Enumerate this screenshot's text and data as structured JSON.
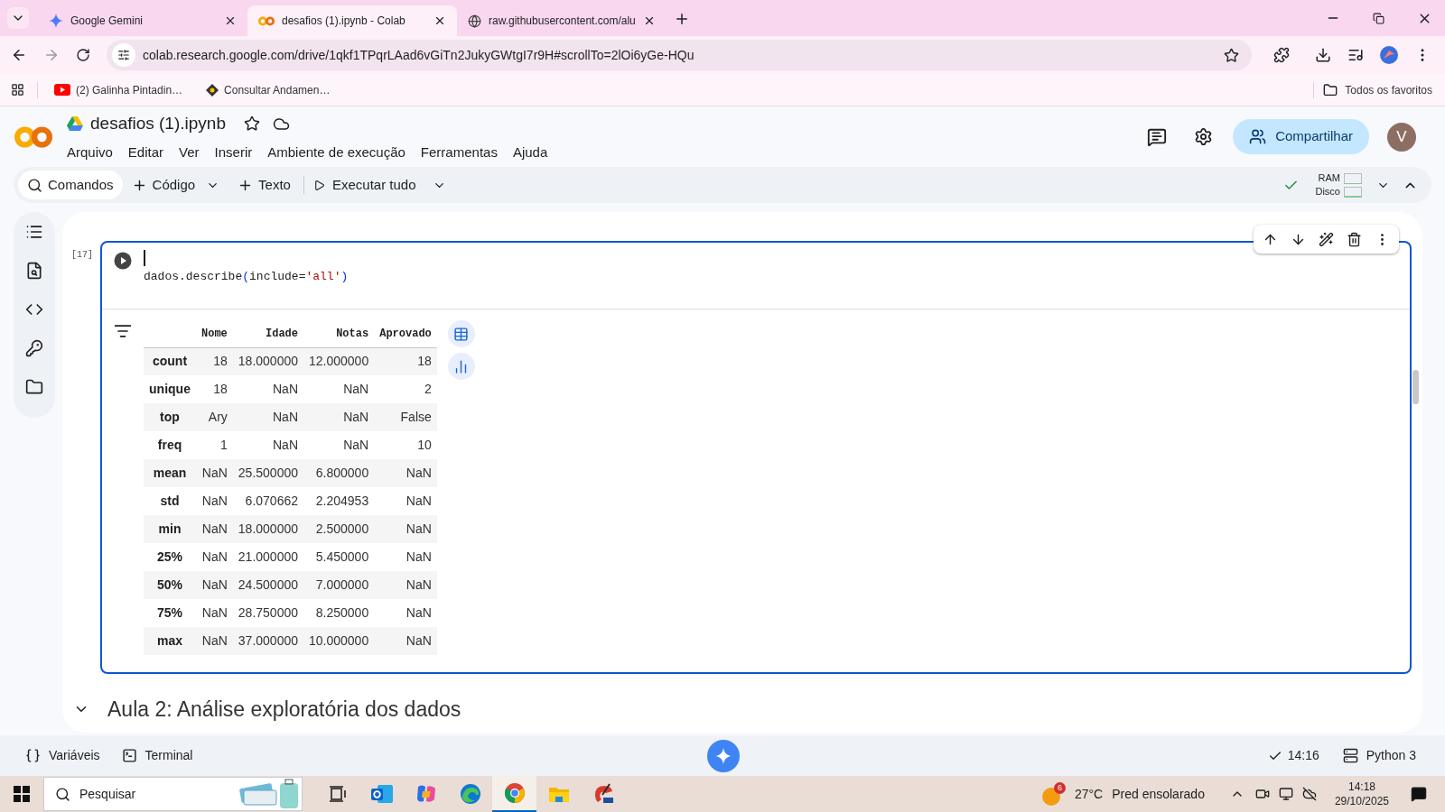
{
  "browser": {
    "tabs": [
      {
        "title": "Google Gemini",
        "kind": "gemini",
        "selected": false
      },
      {
        "title": "desafios (1).ipynb - Colab",
        "kind": "colab",
        "selected": true
      },
      {
        "title": "raw.githubusercontent.com/alu",
        "kind": "globe",
        "selected": false
      }
    ],
    "url": "colab.research.google.com/drive/1qkf1TPqrLAad6vGiTn2JukyGWtgI7r9H#scrollTo=2lOi6yGe-HQu",
    "bookmarks": [
      {
        "title": "(2) Galinha Pintadin…",
        "kind": "youtube"
      },
      {
        "title": "Consultar Andamen…",
        "kind": "diamond"
      }
    ],
    "all_bookmarks": "Todos os favoritos"
  },
  "colab": {
    "notebook_title": "desafios (1).ipynb",
    "menu": [
      "Arquivo",
      "Editar",
      "Ver",
      "Inserir",
      "Ambiente de execução",
      "Ferramentas",
      "Ajuda"
    ],
    "share": "Compartilhar",
    "avatar": "V"
  },
  "toolbar": {
    "commands": "Comandos",
    "code": "Código",
    "text": "Texto",
    "run_all": "Executar tudo",
    "ram": "RAM",
    "disk": "Disco"
  },
  "cell": {
    "exec_count": "[17]",
    "code": [
      {
        "text": "dados.describe",
        "kind": "plain"
      },
      {
        "text": "(",
        "kind": "paren"
      },
      {
        "text": "include=",
        "kind": "plain"
      },
      {
        "text": "'all'",
        "kind": "string"
      },
      {
        "text": ")",
        "kind": "paren"
      }
    ],
    "table": {
      "columns": [
        "Nome",
        "Idade",
        "Notas",
        "Aprovado"
      ],
      "rows": [
        {
          "label": "count",
          "values": [
            "18",
            "18.000000",
            "12.000000",
            "18"
          ]
        },
        {
          "label": "unique",
          "values": [
            "18",
            "NaN",
            "NaN",
            "2"
          ]
        },
        {
          "label": "top",
          "values": [
            "Ary",
            "NaN",
            "NaN",
            "False"
          ]
        },
        {
          "label": "freq",
          "values": [
            "1",
            "NaN",
            "NaN",
            "10"
          ]
        },
        {
          "label": "mean",
          "values": [
            "NaN",
            "25.500000",
            "6.800000",
            "NaN"
          ]
        },
        {
          "label": "std",
          "values": [
            "NaN",
            "6.070662",
            "2.204953",
            "NaN"
          ]
        },
        {
          "label": "min",
          "values": [
            "NaN",
            "18.000000",
            "2.500000",
            "NaN"
          ]
        },
        {
          "label": "25%",
          "values": [
            "NaN",
            "21.000000",
            "5.450000",
            "NaN"
          ]
        },
        {
          "label": "50%",
          "values": [
            "NaN",
            "24.500000",
            "7.000000",
            "NaN"
          ]
        },
        {
          "label": "75%",
          "values": [
            "NaN",
            "28.750000",
            "8.250000",
            "NaN"
          ]
        },
        {
          "label": "max",
          "values": [
            "NaN",
            "37.000000",
            "10.000000",
            "NaN"
          ]
        }
      ]
    }
  },
  "section": {
    "title": "Aula 2: Análise exploratória dos dados",
    "expanded": true
  },
  "status_bar": {
    "variables": "Variáveis",
    "terminal": "Terminal",
    "time": "14:16",
    "runtime": "Python 3"
  },
  "taskbar": {
    "search": "Pesquisar",
    "apps": [
      {
        "kind": "taskview",
        "selected": false
      },
      {
        "kind": "outlook",
        "selected": false
      },
      {
        "kind": "copilot",
        "selected": false
      },
      {
        "kind": "edge",
        "selected": false
      },
      {
        "kind": "chrome",
        "selected": true
      },
      {
        "kind": "explorer",
        "selected": false
      },
      {
        "kind": "cleaner",
        "selected": false
      }
    ],
    "weather_badge": "6",
    "temperature": "27°C",
    "weather": "Pred ensolarado",
    "clock_time": "14:18",
    "clock_date": "29/10/2025"
  }
}
